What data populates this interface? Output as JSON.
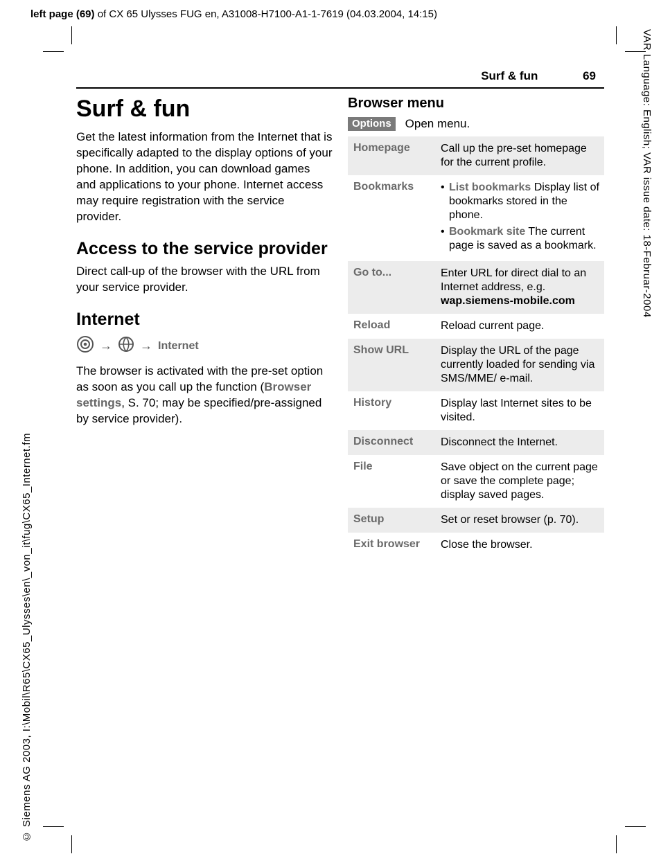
{
  "header": {
    "prefix": "left page (69)",
    "rest": " of CX 65 Ulysses FUG en, A31008-H7100-A1-1-7619 (04.03.2004, 14:15)"
  },
  "right_margin": "VAR Language: English; VAR issue date: 18-Februar-2004",
  "left_margin": "© Siemens AG 2003, I:\\Mobil\\R65\\CX65_Ulysses\\en\\_von_it\\fug\\CX65_Internet.fm",
  "running": {
    "section": "Surf & fun",
    "page": "69"
  },
  "left_col": {
    "title": "Surf & fun",
    "intro": "Get the latest information from the Internet that is specifically adapted to the display options of your phone. In addition, you can download games and applications to your phone. Internet access may require registration with the service provider.",
    "h2a": "Access to the service provider",
    "p2": "Direct call-up of the browser with the URL from your service provider.",
    "h2b": "Internet",
    "nav_label": "Internet",
    "p3a": "The browser is activated with the pre-set option as soon as you call up the function (",
    "p3ref": "Browser settings",
    "p3b": ", S. 70; may be specified/pre-assigned by service provider)."
  },
  "right_col": {
    "h3": "Browser menu",
    "options_label": "Options",
    "options_text": "Open menu.",
    "rows": [
      {
        "label": "Homepage",
        "desc_plain": "Call up the pre-set homepage for the current profile."
      },
      {
        "label": "Bookmarks",
        "bullets": [
          {
            "lead": "List bookmarks",
            "rest": " Display list of bookmarks stored in the phone."
          },
          {
            "lead": "Bookmark site",
            "rest": " The current page is saved as a bookmark."
          }
        ]
      },
      {
        "label": "Go to...",
        "desc_pre": "Enter URL for direct dial to an Internet address, e.g. ",
        "desc_bold": "wap.siemens-mobile.com"
      },
      {
        "label": "Reload",
        "desc_plain": "Reload current page."
      },
      {
        "label": "Show URL",
        "desc_plain": "Display the URL of the page currently loaded for sending via SMS/MME/ e-mail."
      },
      {
        "label": "History",
        "desc_plain": "Display last Internet sites to be visited."
      },
      {
        "label": "Disconnect",
        "desc_plain": "Disconnect the Internet."
      },
      {
        "label": "File",
        "desc_plain": "Save object on the current page or save the complete page; display saved pages."
      },
      {
        "label": "Setup",
        "desc_plain": "Set or reset browser (p. 70)."
      },
      {
        "label": "Exit browser",
        "desc_plain": "Close the browser."
      }
    ]
  }
}
